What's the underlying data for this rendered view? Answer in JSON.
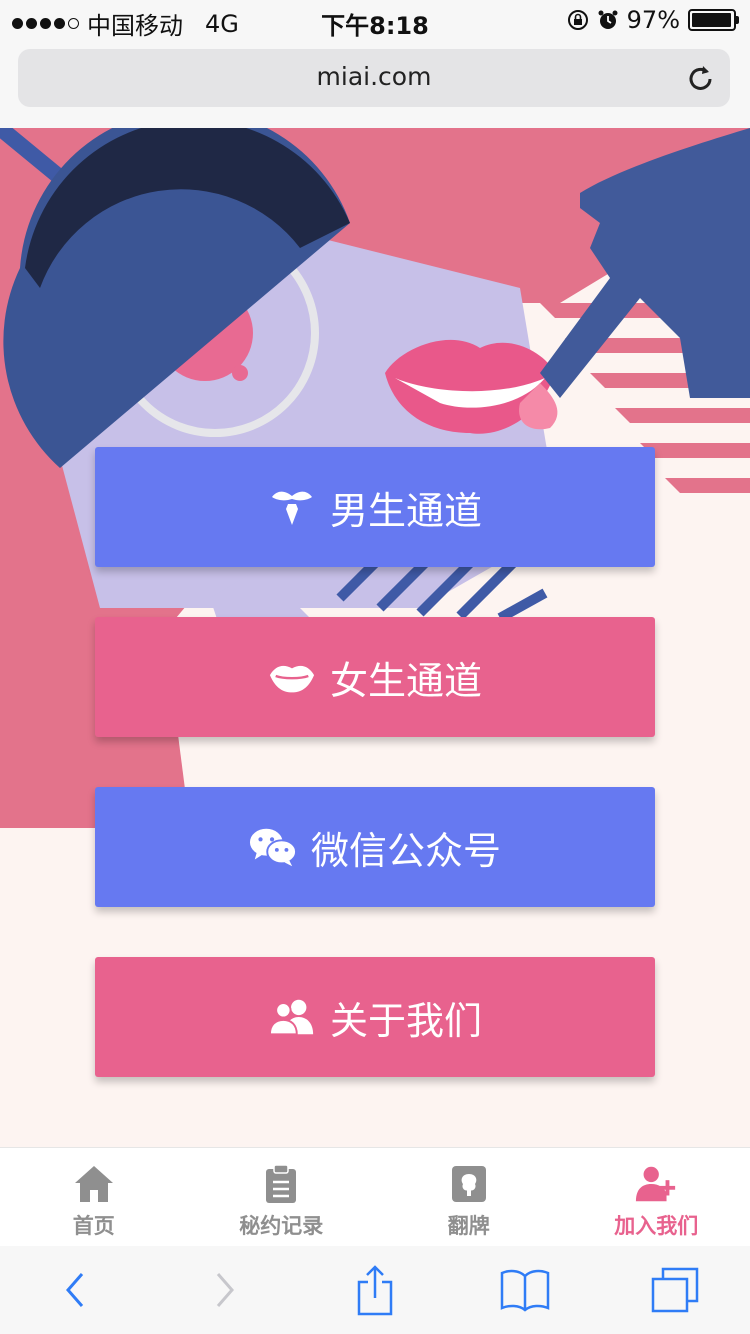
{
  "status_bar": {
    "carrier": "中国移动",
    "network": "4G",
    "time": "下午8:18",
    "battery": "97%",
    "battery_level": 0.97
  },
  "browser": {
    "url": "miai.com"
  },
  "buttons": [
    {
      "label": "男生通道",
      "icon": "mustache-tie-icon"
    },
    {
      "label": "女生通道",
      "icon": "lips-icon"
    },
    {
      "label": "微信公众号",
      "icon": "wechat-icon"
    },
    {
      "label": "关于我们",
      "icon": "users-icon"
    }
  ],
  "tab_bar": {
    "items": [
      {
        "label": "首页",
        "icon": "home-icon"
      },
      {
        "label": "秘约记录",
        "icon": "clipboard-icon"
      },
      {
        "label": "翻牌",
        "icon": "card-icon"
      },
      {
        "label": "加入我们",
        "icon": "add-user-icon"
      }
    ],
    "active_index": 3
  },
  "colors": {
    "blue_button": "#6679f1",
    "pink_button": "#e8628e",
    "active_tab": "#e8628e",
    "ios_blue": "#2f7cf6"
  }
}
